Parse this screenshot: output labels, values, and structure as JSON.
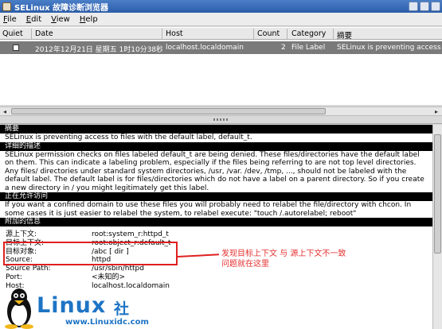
{
  "window": {
    "title": "SELinux 故障诊断浏览器"
  },
  "menu": [
    {
      "label": "File",
      "mnemonic": "F",
      "rest": "ile"
    },
    {
      "label": "Edit",
      "mnemonic": "E",
      "rest": "dit"
    },
    {
      "label": "View",
      "mnemonic": "V",
      "rest": "iew"
    },
    {
      "label": "Help",
      "mnemonic": "H",
      "rest": "elp"
    }
  ],
  "columns": {
    "quiet": "Quiet",
    "date": "Date",
    "host": "Host",
    "count": "Count",
    "category": "Category",
    "summary": "摘要"
  },
  "alert_row": {
    "date": "2012年12月21日 星期五 1时10分38秒",
    "host": "localhost.localdomain",
    "count": "2",
    "category": "File Label",
    "summary": "SELinux is preventing access to"
  },
  "detail": {
    "summary_head": "摘要",
    "summary_text": "SELinux is preventing access to files with the default label, default_t.",
    "desc_head": "详细的描述",
    "desc_text": "SELinux permission checks on files labeled default_t are being denied. These files/directories have the default label on them. This can indicate a labeling problem, especially if the files being referring to are not top level directories. Any files/ directories under standard system directories, /usr, /var. /dev, /tmp, ..., should not be labeled with the default label. The default label is for files/directories which do not have a label on a parent directory. So if you create a new directory in / you might legitimately get this label.",
    "allow_head": "正在允许访问",
    "allow_text": "If you want a confined domain to use these files you will probably need to relabel the file/directory with chcon. In some cases it is just easier to relabel the system, to relabel execute: \"touch /.autorelabel; reboot\"",
    "info_head": "附加的信息",
    "info": [
      {
        "key": "源上下文:",
        "value": "root:system_r:httpd_t"
      },
      {
        "key": "目标上下文:",
        "value": "root:object_r:default_t"
      },
      {
        "key": "目标对象:",
        "value": "/abc [ dir ]"
      },
      {
        "key": "Source:",
        "value": "httpd"
      },
      {
        "key": "Source Path:",
        "value": "/usr/sbin/httpd"
      },
      {
        "key": "Port:",
        "value": "<未知的>"
      },
      {
        "key": "Host:",
        "value": "localhost.localdomain"
      }
    ]
  },
  "annotation": {
    "line1": "发现目标上下文 与 源上下文不一致",
    "line2": "问题就在这里"
  },
  "watermark": {
    "brand": "Linux",
    "she": "社",
    "url": "www.Linuxidc.com"
  }
}
